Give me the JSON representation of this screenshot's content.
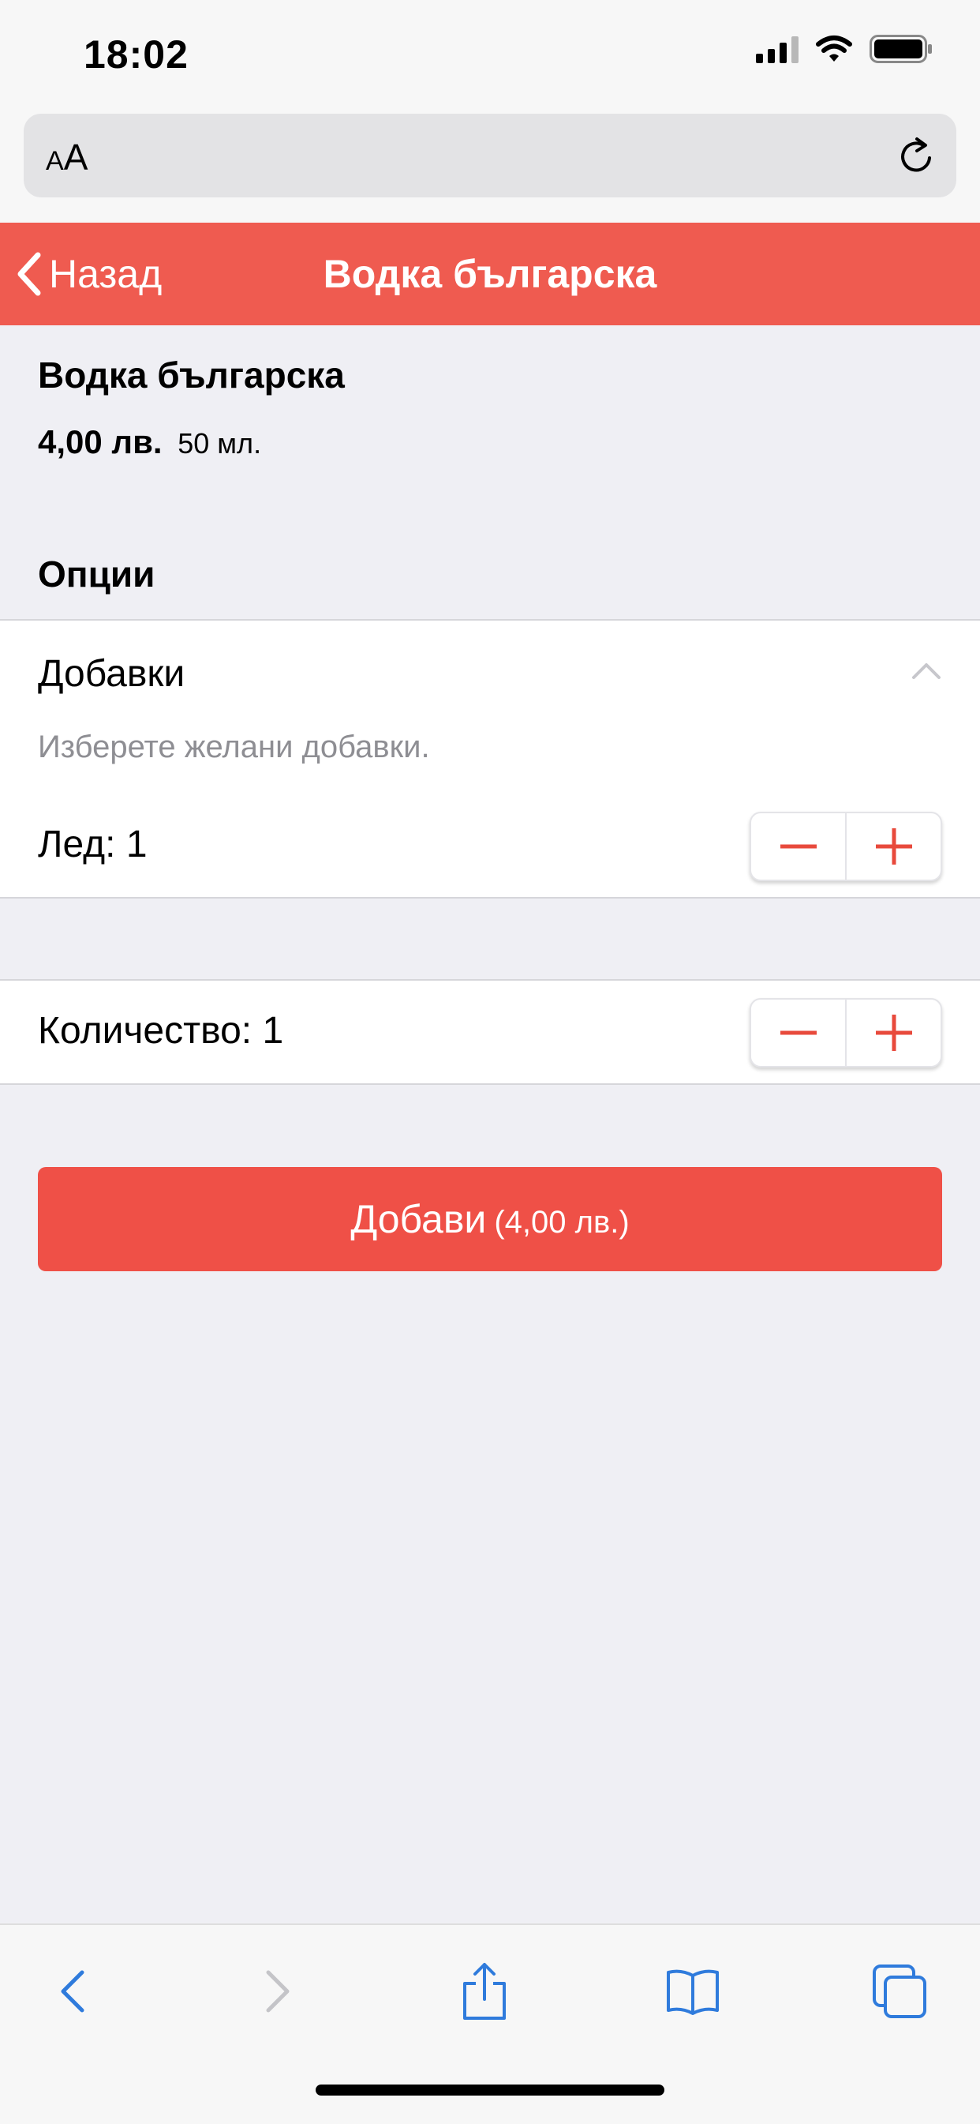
{
  "status_bar": {
    "time": "18:02"
  },
  "browser": {
    "text_size_button": {
      "small": "A",
      "large": "A"
    }
  },
  "header": {
    "back_label": "Назад",
    "title": "Водка българска"
  },
  "product": {
    "name": "Водка българска",
    "price": "4,00 лв.",
    "volume": "50 мл."
  },
  "options": {
    "heading": "Опции",
    "addons": {
      "title": "Добавки",
      "hint": "Изберете желани добавки.",
      "items": [
        {
          "label": "Лед",
          "quantity": "1"
        }
      ]
    }
  },
  "quantity": {
    "label": "Количество",
    "value": "1"
  },
  "add_button": {
    "label": "Добави",
    "price": "(4,00 лв.)"
  },
  "colors": {
    "accent": "#ef5047",
    "header": "#ef5b50",
    "ios_blue": "#2f7bdc",
    "background": "#efeff4"
  },
  "icons": {
    "back": "chevron-left-icon",
    "reload": "reload-icon",
    "collapse": "chevron-up-icon",
    "minus": "minus-icon",
    "plus": "plus-icon",
    "share": "share-icon",
    "bookmarks": "book-icon",
    "tabs": "tabs-icon"
  }
}
